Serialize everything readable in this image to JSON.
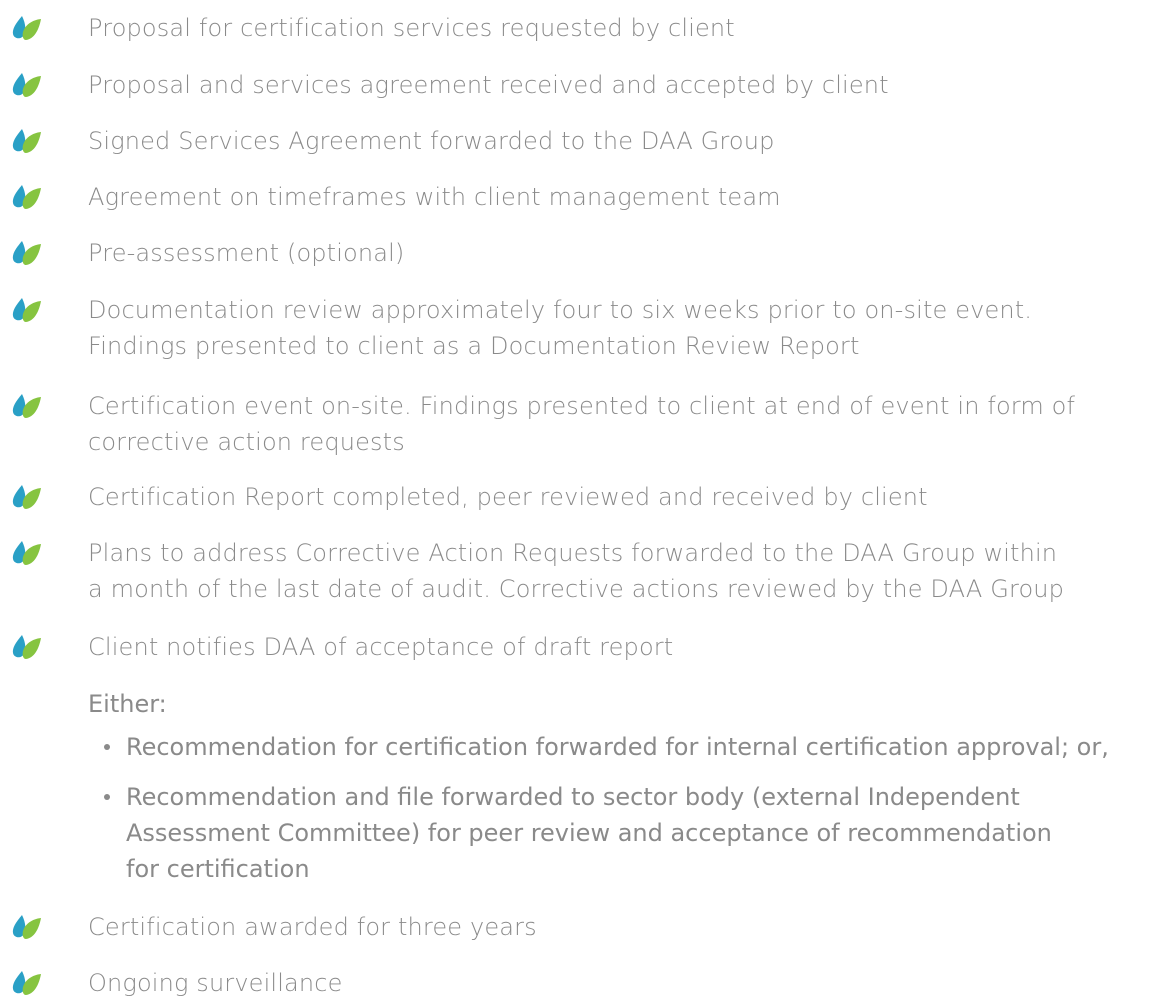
{
  "colors": {
    "text": "#8a8a8a",
    "leaf_teal": "#2aa0c6",
    "leaf_green": "#86c440"
  },
  "icon": "leaf-icon",
  "steps": [
    {
      "text": "Proposal for certification services requested by client"
    },
    {
      "text": "Proposal and services agreement received and accepted by client"
    },
    {
      "text": "Signed Services Agreement forwarded to the DAA Group"
    },
    {
      "text": "Agreement on timeframes with client management team"
    },
    {
      "text": "Pre-assessment (optional)"
    },
    {
      "text": "Documentation review approximately four to six weeks prior to on-site event.\nFindings presented to client as a Documentation Review Report"
    },
    {
      "text": "Certification event on-site. Findings presented to client at end of event in form of\ncorrective action requests"
    },
    {
      "text": "Certification Report completed, peer reviewed and received by client"
    },
    {
      "text": "Plans to address Corrective Action Requests forwarded to the DAA Group within\na month of the last date of audit. Corrective actions reviewed by the DAA Group"
    },
    {
      "text": "Client notifies DAA of acceptance of draft report"
    }
  ],
  "either": {
    "label": "Either:",
    "options": [
      {
        "text": "Recommendation for certification forwarded for internal certification approval; or,"
      },
      {
        "text": "Recommendation and file forwarded to sector body (external Independent\nAssessment Committee) for peer review and acceptance of recommendation\nfor certification"
      }
    ]
  },
  "final_steps": [
    {
      "text": "Certification awarded for three years"
    },
    {
      "text": "Ongoing surveillance"
    }
  ]
}
